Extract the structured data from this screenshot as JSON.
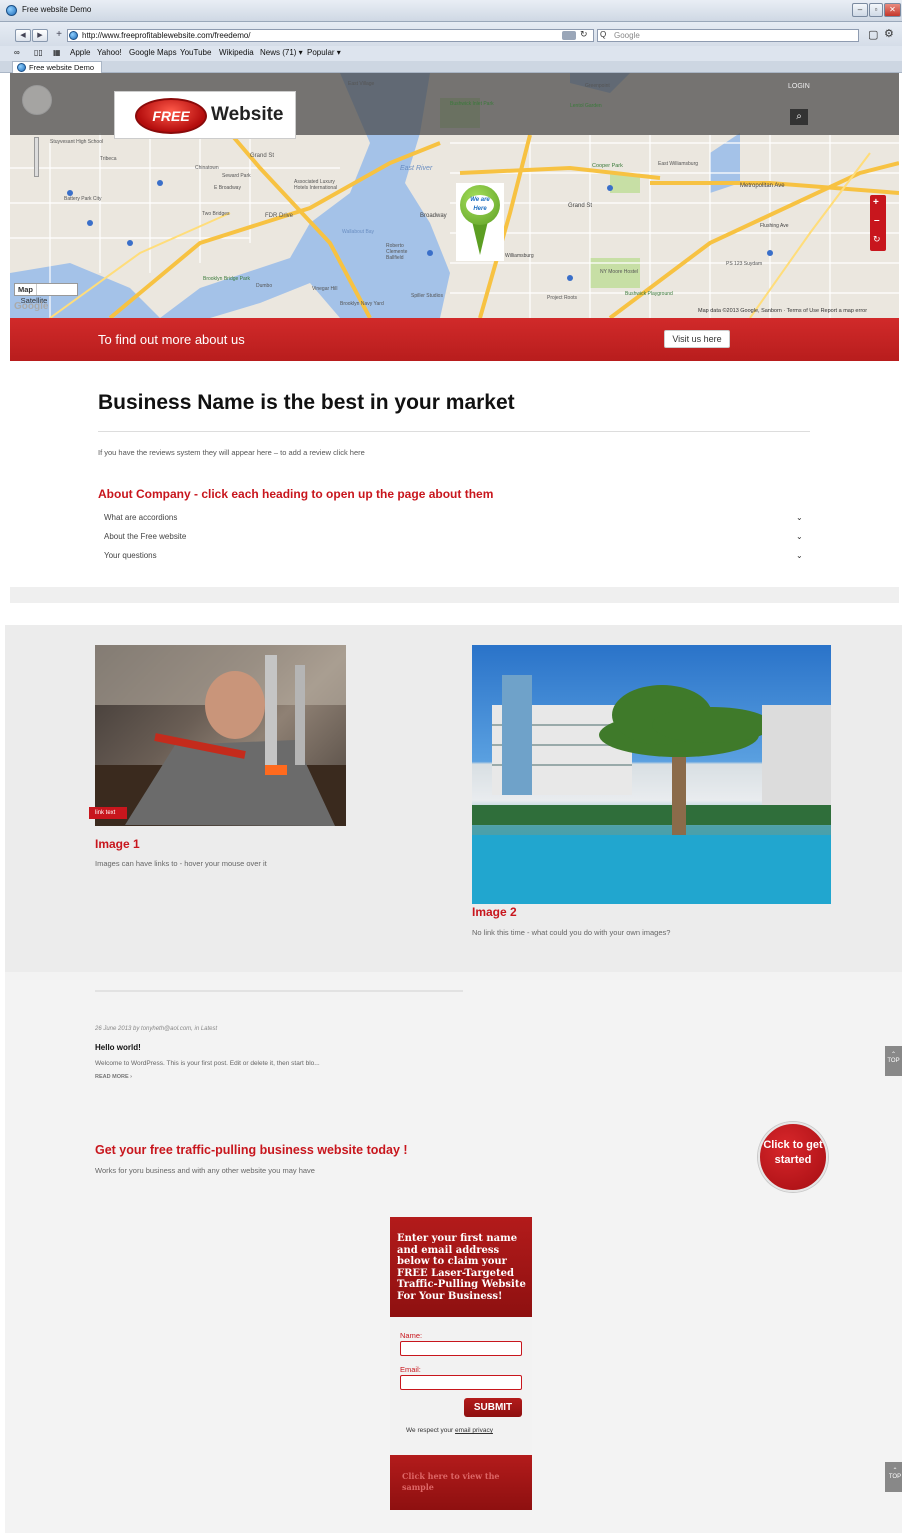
{
  "browser": {
    "window_title": "Free website Demo",
    "url": "http://www.freeprofitablewebsite.com/freedemo/",
    "search_placeholder": "Google",
    "bookmarks": [
      "Apple",
      "Yahoo!",
      "Google Maps",
      "YouTube",
      "Wikipedia",
      "News (71) ▾",
      "Popular ▾"
    ],
    "tab_label": "Free website Demo"
  },
  "header": {
    "logo_badge": "FREE",
    "logo_text": "Website",
    "login": "LOGIN"
  },
  "map": {
    "pin_label": "We are Here",
    "type_map": "Map",
    "type_satellite": "Satellite",
    "google": "Google",
    "credit": "Map data ©2013 Google, Sanborn · Terms of Use  Report a map error",
    "labels": [
      "East Village",
      "Bushwick Inlet Park",
      "Williamsburg",
      "East River",
      "Chinatown",
      "Two Bridges",
      "Battery Park City",
      "Tribeca",
      "Brooklyn Bridge Park",
      "Dumbo",
      "Vinegar Hill",
      "Wallabout Bay",
      "Brooklyn Navy Yard",
      "Metropolitan Ave",
      "Grand St",
      "Broadway",
      "Cooper Park",
      "East Williamsburg",
      "Flushing Ave",
      "Bushwick Playground",
      "NY Moore Hostel",
      "PS 123 Suydam",
      "Lentol Garden",
      "Greenpoint",
      "Stuyvesant High School",
      "Grand St",
      "FDR Drive",
      "Seward Park",
      "E Broadway",
      "Associated Luxury Hotels International",
      "Roberto Clemente Ballfield",
      "Spiller Studios",
      "Project Roots"
    ]
  },
  "redbar": {
    "text": "To find out more about us",
    "button": "Visit us here"
  },
  "content": {
    "title": "Business Name is the best in your market",
    "reviews": "If you have the reviews system they will appear here – to add a review click here",
    "about_heading": "About Company - click each heading to open up the page about them",
    "accordions": [
      "What are accordions",
      "About the Free website",
      "Your questions"
    ]
  },
  "images": [
    {
      "title": "Image 1",
      "caption": "Images can have links to - hover your mouse over it",
      "link": "link text"
    },
    {
      "title": "Image 2",
      "caption": "No link this time - what could you do with your own images?"
    }
  ],
  "blog": {
    "meta": "26 June 2013 by tonyheth@aol.com,  in Latest",
    "post_title": "Hello world!",
    "excerpt": "Welcome to WordPress. This is your first post. Edit or delete it, then start blo...",
    "read_more": "READ MORE ›"
  },
  "cta": {
    "heading": "Get your free traffic-pulling business website today !",
    "sub": "Works for yoru business and with any other website you may have",
    "circle": "Click to get started"
  },
  "form": {
    "heading": "Enter your first name and email address below to claim your FREE Laser-Targeted Traffic-Pulling Website For Your Business!",
    "name_label": "Name:",
    "email_label": "Email:",
    "submit": "SUBMIT",
    "privacy_prefix": "We respect your ",
    "privacy_link": "email privacy",
    "footer": "Click here to view the sample"
  },
  "top_label": "TOP",
  "colors": {
    "brand_red": "#c8161d",
    "map_water": "#a4c2e8"
  }
}
